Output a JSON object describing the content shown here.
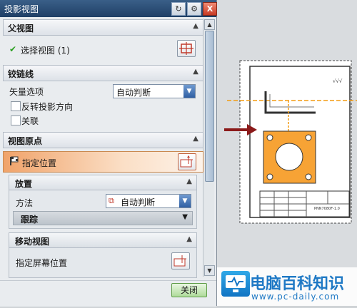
{
  "window": {
    "title": "投影视图",
    "buttons": {
      "reset": "↻",
      "settings": "⚙",
      "close": "X"
    }
  },
  "sections": {
    "parent_view": {
      "header": "父视图",
      "select_view_label": "选择视图 (1)",
      "checkmark": "✔"
    },
    "hinge_line": {
      "header": "铰链线",
      "vector_option_label": "矢量选项",
      "vector_option_value": "自动判断",
      "reverse_direction_label": "反转投影方向",
      "associative_label": "关联"
    },
    "view_origin": {
      "header": "视图原点",
      "specify_location_label": "指定位置",
      "placement": {
        "header": "放置",
        "method_label": "方法",
        "method_value": "自动判断",
        "tracking_label": "跟踪"
      },
      "move_view": {
        "header": "移动视图",
        "specify_screen_location_label": "指定屏幕位置"
      }
    }
  },
  "footer": {
    "close_label": "关闭"
  },
  "drawing": {
    "annotation_text": "√√√",
    "title_block_text": "PNN7080F-1.0"
  },
  "watermark": {
    "title": "电脑百科知识",
    "url": "www.pc-daily.com"
  },
  "colors": {
    "accent_orange": "#f7a335",
    "selection_orange": "#f0a36a",
    "title_blue": "#1f3f66",
    "watermark_blue": "#1f79c5"
  }
}
